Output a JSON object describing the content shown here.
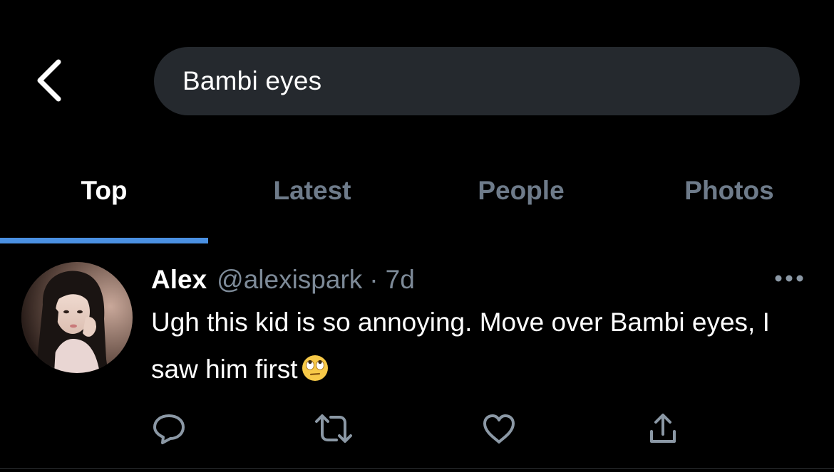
{
  "header": {
    "back_icon": "chevron-left-icon",
    "search_query": "Bambi eyes"
  },
  "tabs": [
    {
      "label": "Top",
      "active": true
    },
    {
      "label": "Latest",
      "active": false
    },
    {
      "label": "People",
      "active": false
    },
    {
      "label": "Photos",
      "active": false
    }
  ],
  "tweet": {
    "author_name": "Alex",
    "author_handle": "@alexispark",
    "separator": "·",
    "timestamp": "7d",
    "text": "Ugh this kid is so annoying. Move over Bambi eyes, I saw him first",
    "emoji": "face-with-rolling-eyes-emoji",
    "more_icon": "more-horizontal-icon",
    "actions": [
      {
        "name": "reply",
        "icon": "reply-bubble-icon"
      },
      {
        "name": "retweet",
        "icon": "retweet-icon"
      },
      {
        "name": "like",
        "icon": "heart-icon"
      },
      {
        "name": "share",
        "icon": "share-upload-icon"
      }
    ]
  },
  "colors": {
    "background": "#000000",
    "search_bg": "#25292e",
    "accent": "#4a90e2",
    "muted_text": "#6e7b8a",
    "handle_text": "#7d8a98",
    "icon": "#8b98a5"
  }
}
